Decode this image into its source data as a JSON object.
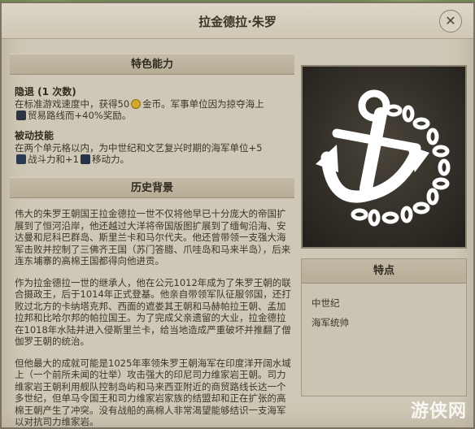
{
  "window": {
    "title": "拉金德拉·朱罗",
    "close_label": "✕"
  },
  "ability": {
    "section_title": "特色能力",
    "retreat_title": "隐退 (1 次数)",
    "retreat_line1_a": "在标准游戏速度中，获得50",
    "retreat_line1_b": "金币。军事单位因为掠夺海上",
    "retreat_line2": "贸易路线而+40%奖励。",
    "passive_title": "被动技能",
    "passive_line1": "在两个单元格以内，为中世纪和文艺复兴时期的海军单位+5",
    "passive_line2_a": "战斗力和+1",
    "passive_line2_b": "移动力。"
  },
  "history": {
    "section_title": "历史背景",
    "p1": "伟大的朱罗王朝国王拉金德拉一世不仅将他早已十分庞大的帝国扩展到了恒河沿岸，他还越过大洋将帝国版图扩展到了缅甸沿海、安达曼和尼科巴群岛、斯里兰卡和马尔代夫。他还曾带领一支强大海军击败并控制了三佛齐王国（苏门答腊、爪哇岛和马来半岛），后来连东埔寨的高棉王国都得向他进贡。",
    "p2": "作为拉金德拉一世的继承人，他在公元1012年成为了朱罗王朝的联合摄政王，后于1014年正式登基。他亲自带领军队征服邻国，还打败过北方的卡纳塔克邦、西面的遮娄其王朝和马赫帕拉王朝、孟加拉邦和比哈尔邦的帕拉国王。为了完成父亲遗留的大业，拉金德拉在1018年水陆并进入侵斯里兰卡，给当地造成严重破坏并推翻了僧伽罗王朝的统治。",
    "p3": "但他最大的成就可能是1025年率领朱罗王朝海军在印度洋开阔水域上（一个前所未闻的壮举）攻击强大的印尼司力维家岩王朝。司力维家岩王朝利用舰队控制岛屿和马来西亚附近的商贸路线长达一个多世纪，但单马令国王和司力维家岩家族的结盟却和正在扩张的高棉王朝产生了冲突。没有战船的高棉人非常渴望能够结识一支海军以对抗司力维家岩。"
  },
  "features": {
    "section_title": "特点",
    "items": [
      "中世纪",
      "海军统帅"
    ]
  },
  "emblem": {
    "icon": "anchor-icon"
  },
  "watermark": "游侠网",
  "colors": {
    "panel": "#d0c8b6",
    "emblem_bg": "#2e2a24",
    "text": "#3c3528"
  }
}
